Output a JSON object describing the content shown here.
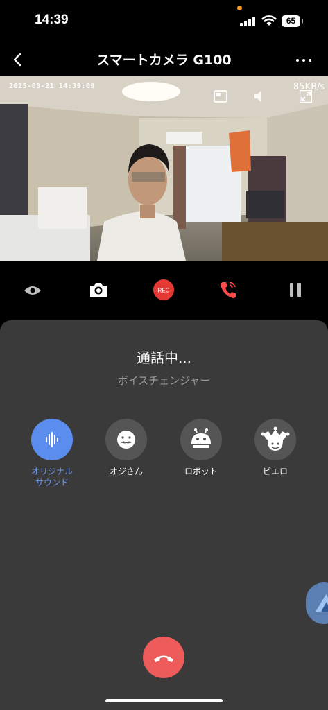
{
  "status_bar": {
    "time": "14:39",
    "battery": "65"
  },
  "nav": {
    "title": "スマートカメラ G100"
  },
  "video": {
    "timestamp": "2025-08-21 14:39:09",
    "bitrate": "85KB/s"
  },
  "call": {
    "status": "通話中...",
    "voice_changer_label": "ボイスチェンジャー"
  },
  "voice_options": [
    {
      "label_line1": "オリジナル",
      "label_line2": "サウンド",
      "active": true
    },
    {
      "label_line1": "オジさん",
      "label_line2": "",
      "active": false
    },
    {
      "label_line1": "ロボット",
      "label_line2": "",
      "active": false
    },
    {
      "label_line1": "ピエロ",
      "label_line2": "",
      "active": false
    }
  ],
  "colors": {
    "accent": "#5b8def",
    "record": "#e53935",
    "hangup": "#ee5b5b",
    "panel": "#3a3a3a"
  }
}
